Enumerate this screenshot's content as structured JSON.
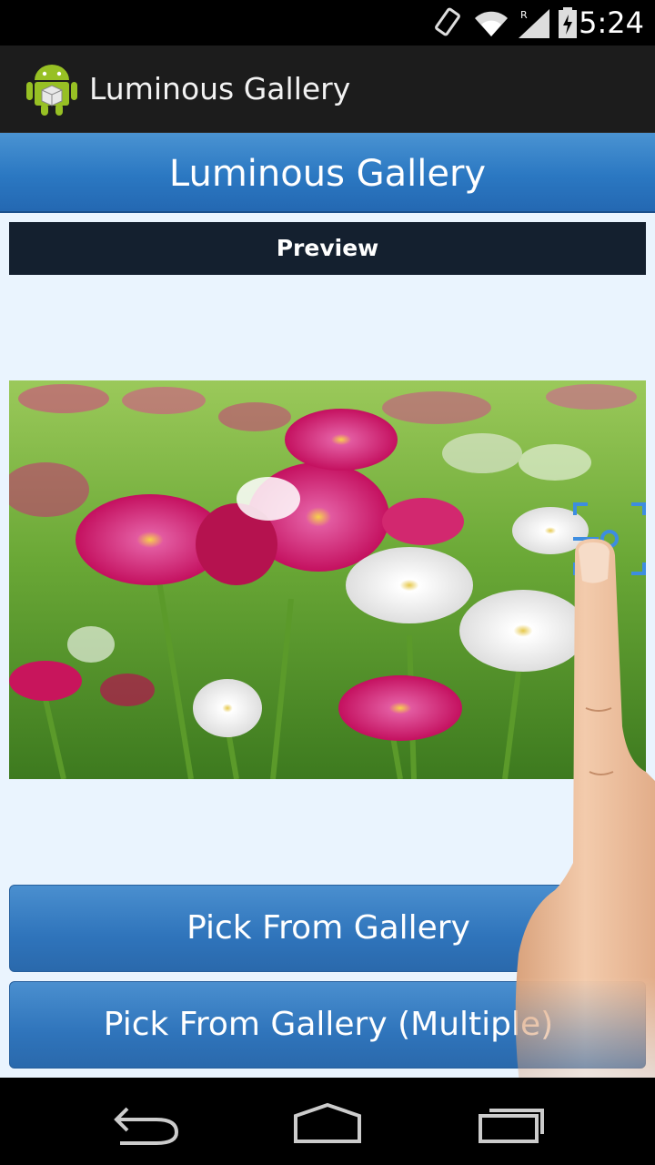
{
  "status_bar": {
    "time": "5:24",
    "icons": [
      "screen-rotate-icon",
      "wifi-icon",
      "signal-icon",
      "battery-icon"
    ]
  },
  "action_bar": {
    "app_icon": "android-icon",
    "title": "Luminous Gallery"
  },
  "main": {
    "header_title": "Luminous Gallery",
    "preview_label": "Preview",
    "image": "flower-photo",
    "buttons": {
      "pick": "Pick From Gallery",
      "pick_multiple": "Pick From Gallery (Multiple)"
    }
  },
  "nav_bar": {
    "icons": [
      "back-icon",
      "home-icon",
      "recents-icon"
    ]
  },
  "colors": {
    "accent": "#2b78c2",
    "preview_bar": "#14202f",
    "content_bg": "#eaf4fe"
  }
}
